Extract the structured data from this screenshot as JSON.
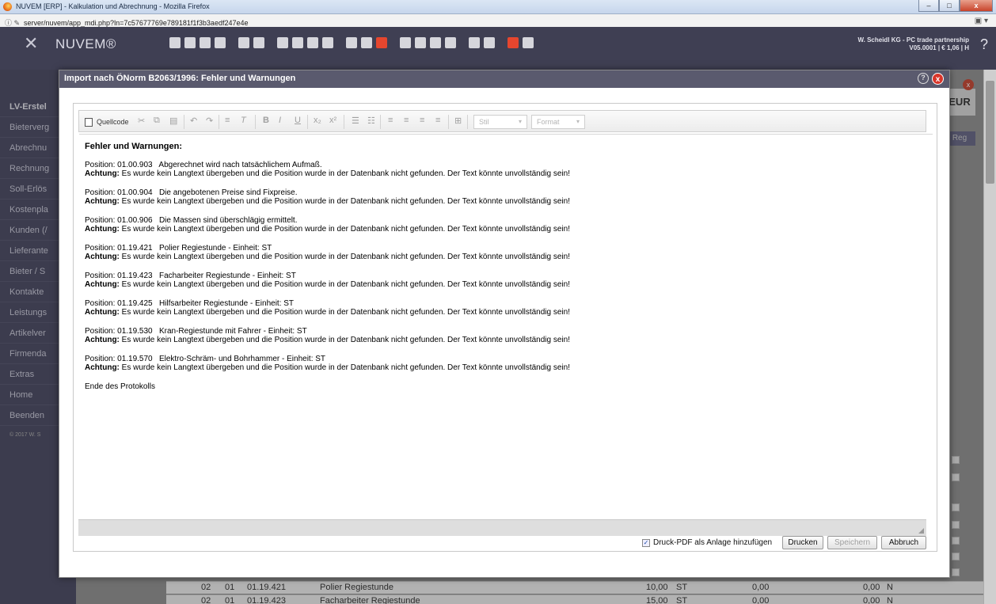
{
  "browser": {
    "window_title": "NUVEM [ERP] - Kalkulation und Abrechnung - Mozilla Firefox",
    "url": "server/nuvem/app_mdi.php?ln=7c57677769e789181f1f3b3aedf247e4e",
    "winbtn_min": "–",
    "winbtn_max": "□",
    "winbtn_close": "x"
  },
  "app": {
    "logo": "NUVEM®",
    "company_line1": "W. Scheidl KG - PC trade partnership",
    "company_line2": "V05.0001 | € 1,06 | H",
    "help": "?"
  },
  "sidebar": {
    "items": [
      {
        "label": "LV-Erstel"
      },
      {
        "label": "Bieterverg"
      },
      {
        "label": "Abrechnu"
      },
      {
        "label": "Rechnung"
      },
      {
        "label": "Soll-Erlös"
      },
      {
        "label": "Kostenpla"
      },
      {
        "label": "Kunden (/"
      },
      {
        "label": "Lieferante"
      },
      {
        "label": "Bieter / S"
      },
      {
        "label": "Kontakte"
      },
      {
        "label": "Leistungs"
      },
      {
        "label": "Artikelver"
      },
      {
        "label": "Firmenda"
      },
      {
        "label": "Extras"
      },
      {
        "label": "Home"
      },
      {
        "label": "Beenden"
      }
    ],
    "copyright": "© 2017 W. S"
  },
  "background": {
    "eur": "EUR",
    "reg": "Reg",
    "close": "x",
    "rows": [
      {
        "a": "02",
        "b": "01",
        "pos": "01.19.421",
        "text": "Polier Regiestunde",
        "qty": "10,00",
        "unit": "ST",
        "price": "0,00",
        "total": "0,00",
        "flag": "N"
      },
      {
        "a": "02",
        "b": "01",
        "pos": "01.19.423",
        "text": "Facharbeiter Regiestunde",
        "qty": "15,00",
        "unit": "ST",
        "price": "0,00",
        "total": "0,00",
        "flag": "N"
      }
    ]
  },
  "modal": {
    "title": "Import nach ÖNorm B2063/1996: Fehler und Warnungen",
    "help": "?",
    "close": "x",
    "toolbar": {
      "source": "Quellcode",
      "style_combo": "Stil",
      "format_combo": "Format"
    },
    "content": {
      "heading": "Fehler und Warnungen:",
      "warning_label": "Achtung:",
      "warning_text": " Es wurde kein Langtext übergeben und die Position wurde in der Datenbank nicht gefunden. Der Text könnte unvollständig sein!",
      "entries": [
        {
          "position": "Position: 01.00.903   Abgerechnet wird nach tatsächlichem Aufmaß."
        },
        {
          "position": "Position: 01.00.904   Die angebotenen Preise sind Fixpreise."
        },
        {
          "position": "Position: 01.00.906   Die Massen sind überschlägig ermittelt."
        },
        {
          "position": "Position: 01.19.421   Polier Regiestunde - Einheit: ST"
        },
        {
          "position": "Position: 01.19.423   Facharbeiter Regiestunde - Einheit: ST"
        },
        {
          "position": "Position: 01.19.425   Hilfsarbeiter Regiestunde - Einheit: ST"
        },
        {
          "position": "Position: 01.19.530   Kran-Regiestunde mit Fahrer - Einheit: ST"
        },
        {
          "position": "Position: 01.19.570   Elektro-Schräm- und Bohrhammer - Einheit: ST"
        }
      ],
      "footer": "Ende des Protokolls"
    },
    "bottom": {
      "checkbox_label": "Druck-PDF als Anlage hinzufügen",
      "checkbox_mark": "✓",
      "print": "Drucken",
      "save": "Speichern",
      "cancel": "Abbruch"
    }
  }
}
